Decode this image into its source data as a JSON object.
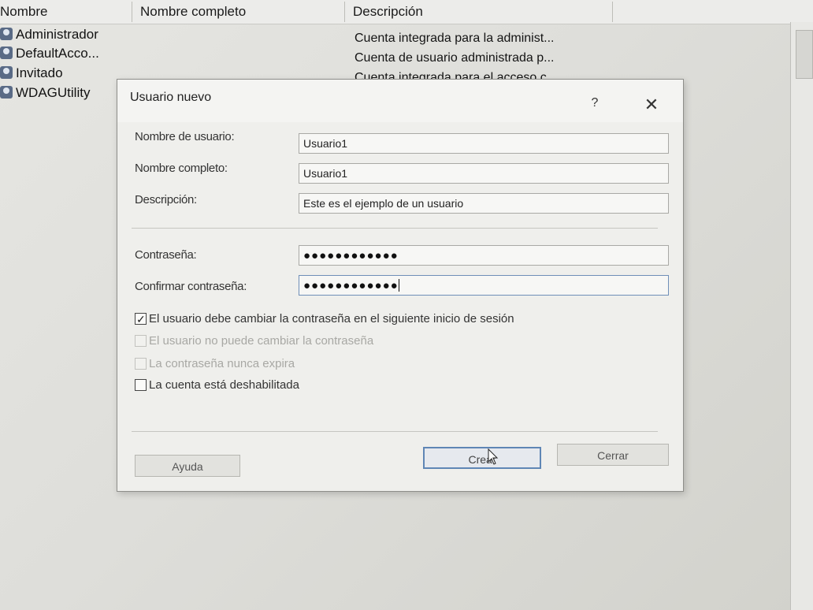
{
  "list": {
    "columns": [
      "Nombre",
      "Nombre completo",
      "Descripción"
    ],
    "rows": [
      {
        "name": "Administrador",
        "description": "Cuenta integrada para la administ..."
      },
      {
        "name": "DefaultAcco...",
        "description": "Cuenta de usuario administrada p..."
      },
      {
        "name": "Invitado",
        "description": "Cuenta integrada para el acceso c..."
      },
      {
        "name": "WDAGUtility",
        "description": ""
      }
    ]
  },
  "dialog": {
    "title": "Usuario nuevo",
    "help_label": "?",
    "close_label": "✕",
    "fields": {
      "username_label": "Nombre de usuario:",
      "username_value": "Usuario1",
      "fullname_label": "Nombre completo:",
      "fullname_value": "Usuario1",
      "description_label": "Descripción:",
      "description_value": "Este es el ejemplo de un usuario",
      "password_label": "Contraseña:",
      "password_value": "●●●●●●●●●●●●",
      "confirm_label": "Confirmar contraseña:",
      "confirm_value": "●●●●●●●●●●●●"
    },
    "options": [
      {
        "label": "El usuario debe cambiar la contraseña en el siguiente inicio de sesión",
        "checked": true,
        "enabled": true
      },
      {
        "label": "El usuario no puede cambiar la contraseña",
        "checked": false,
        "enabled": false
      },
      {
        "label": "La contraseña nunca expira",
        "checked": false,
        "enabled": false
      },
      {
        "label": "La cuenta está deshabilitada",
        "checked": false,
        "enabled": true
      }
    ],
    "buttons": {
      "help": "Ayuda",
      "create": "Crear",
      "close": "Cerrar"
    }
  }
}
